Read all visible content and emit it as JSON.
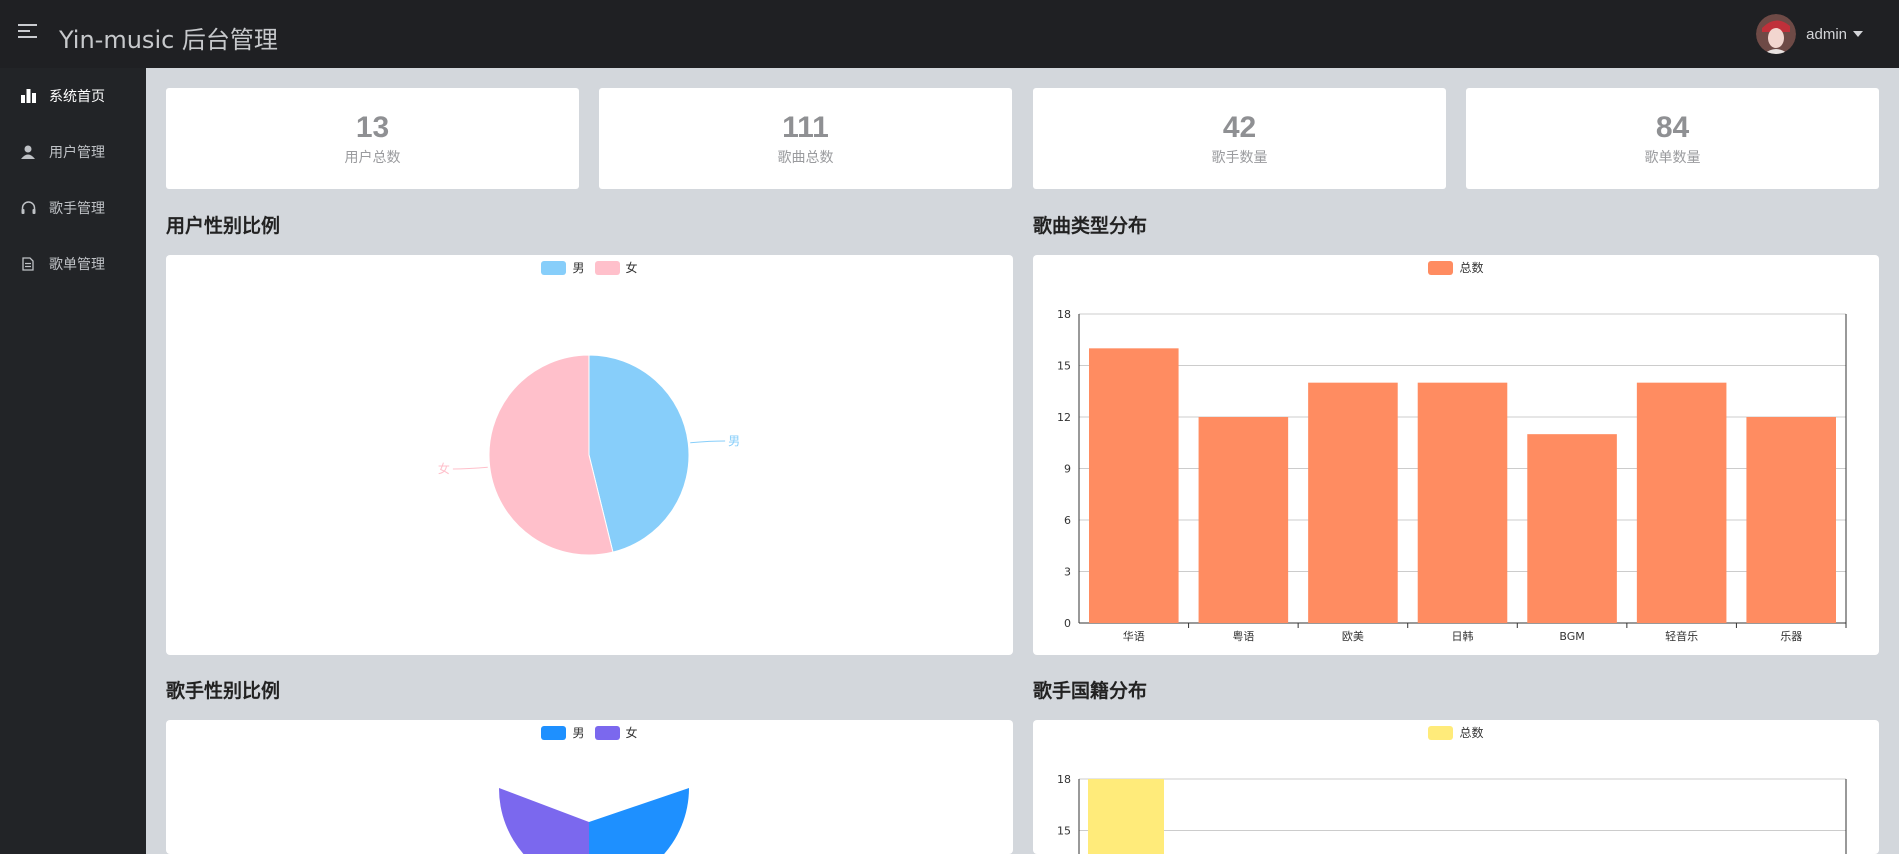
{
  "app": {
    "title": "Yin-music 后台管理"
  },
  "user": {
    "name": "admin"
  },
  "sidebar": {
    "items": [
      {
        "label": "系统首页",
        "icon": "bar-chart-icon",
        "active": true
      },
      {
        "label": "用户管理",
        "icon": "user-icon"
      },
      {
        "label": "歌手管理",
        "icon": "headphones-icon"
      },
      {
        "label": "歌单管理",
        "icon": "document-icon"
      }
    ]
  },
  "stats": [
    {
      "value": "13",
      "label": "用户总数"
    },
    {
      "value": "111",
      "label": "歌曲总数"
    },
    {
      "value": "42",
      "label": "歌手数量"
    },
    {
      "value": "84",
      "label": "歌单数量"
    }
  ],
  "sections": {
    "user_gender": "用户性别比例",
    "song_type": "歌曲类型分布",
    "singer_gender": "歌手性别比例",
    "singer_country": "歌手国籍分布"
  },
  "chart_data": [
    {
      "type": "pie",
      "labels": [
        "男",
        "女"
      ],
      "values": [
        6,
        7
      ],
      "colors": [
        "#87cefa",
        "#ffc0cb"
      ]
    },
    {
      "type": "bar",
      "categories": [
        "华语",
        "粤语",
        "欧美",
        "日韩",
        "BGM",
        "轻音乐",
        "乐器"
      ],
      "series": [
        {
          "name": "总数",
          "values": [
            16,
            12,
            14,
            14,
            11,
            14,
            12
          ]
        }
      ],
      "ylim": [
        0,
        18
      ],
      "yticks": [
        0,
        3,
        6,
        9,
        12,
        15,
        18
      ],
      "color": "#ff8c61",
      "grid": true
    },
    {
      "type": "pie",
      "labels": [
        "男",
        "女"
      ],
      "colors": [
        "#1e90ff",
        "#7b68ee"
      ]
    },
    {
      "type": "bar",
      "series": [
        {
          "name": "总数",
          "values": [
            18
          ]
        }
      ],
      "ylim": [
        0,
        18
      ],
      "yticks": [
        15,
        18
      ],
      "color": "#ffeb7a",
      "grid": true
    }
  ]
}
